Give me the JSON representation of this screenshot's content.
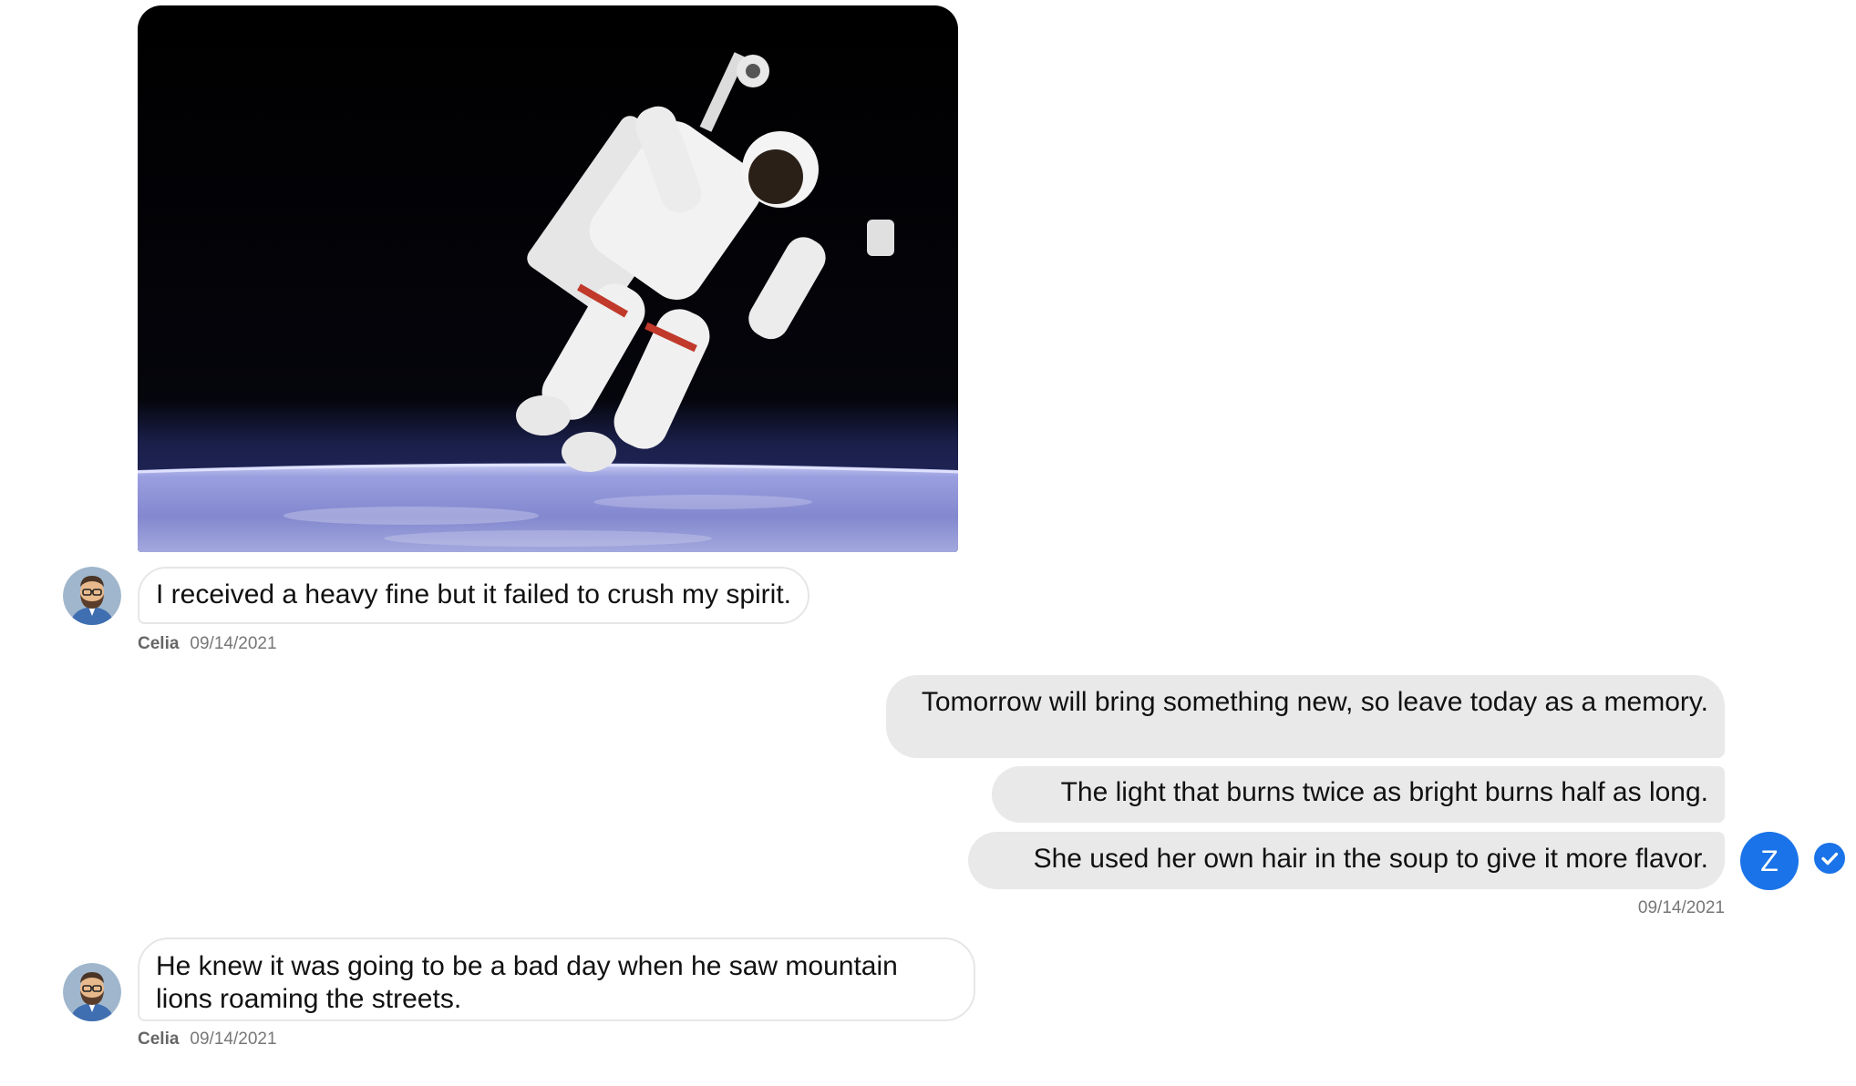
{
  "conversation": {
    "attachment": {
      "icon": "astronaut-photo"
    },
    "messages": [
      {
        "direction": "incoming",
        "sender": "Celia",
        "text": "I received a heavy fine but it failed to crush my spirit.",
        "timestamp": "09/14/2021",
        "avatar_icon": "bearded-man-avatar"
      },
      {
        "direction": "outgoing",
        "text": "Tomorrow will bring something new, so leave today as a memory."
      },
      {
        "direction": "outgoing",
        "text": "The light that burns twice as bright burns half as long."
      },
      {
        "direction": "outgoing",
        "text": "She used her own hair in the soup to give it more flavor.",
        "timestamp": "09/14/2021",
        "avatar_initial": "Z",
        "receipt_icon": "check-circle-icon"
      },
      {
        "direction": "incoming",
        "sender": "Celia",
        "text": "He knew it was going to be a bad day when he saw mountain lions roaming the streets.",
        "timestamp": "09/14/2021",
        "avatar_icon": "bearded-man-avatar"
      }
    ]
  },
  "colors": {
    "outgoing_bubble": "#e9e9e9",
    "incoming_border": "#e6e6e6",
    "accent": "#1a73e8"
  }
}
